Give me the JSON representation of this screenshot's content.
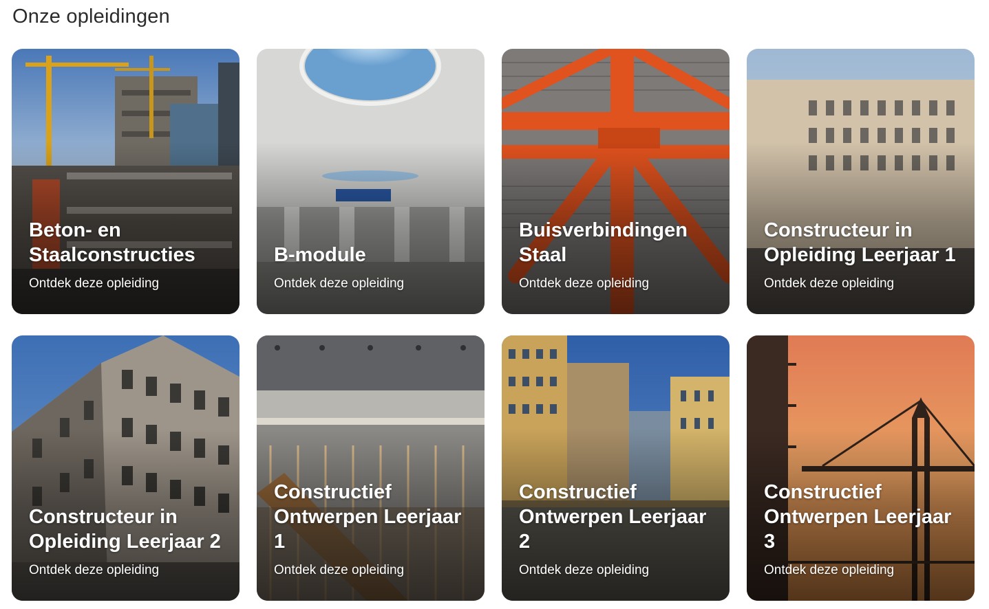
{
  "section": {
    "title": "Onze opleidingen"
  },
  "cards": [
    {
      "title": "Beton- en Staalconstructies",
      "link_label": "Ontdek deze opleiding",
      "image": "construction-site-cranes"
    },
    {
      "title": "B-module",
      "link_label": "Ontdek deze opleiding",
      "image": "station-hall-interior"
    },
    {
      "title": "Buisverbindingen Staal",
      "link_label": "Ontdek deze opleiding",
      "image": "orange-steel-tube-truss"
    },
    {
      "title": "Constructeur in Opleiding Leerjaar 1",
      "link_label": "Ontdek deze opleiding",
      "image": "office-building-facade"
    },
    {
      "title": "Constructeur in Opleiding Leerjaar 2",
      "link_label": "Ontdek deze opleiding",
      "image": "residential-block-facade"
    },
    {
      "title": "Constructief Ontwerpen Leerjaar 1",
      "link_label": "Ontdek deze opleiding",
      "image": "timber-staircase-interior"
    },
    {
      "title": "Constructief Ontwerpen Leerjaar 2",
      "link_label": "Ontdek deze opleiding",
      "image": "colorful-towers-water-reflection"
    },
    {
      "title": "Constructief Ontwerpen Leerjaar 3",
      "link_label": "Ontdek deze opleiding",
      "image": "crane-silhouette-sunset"
    }
  ]
}
